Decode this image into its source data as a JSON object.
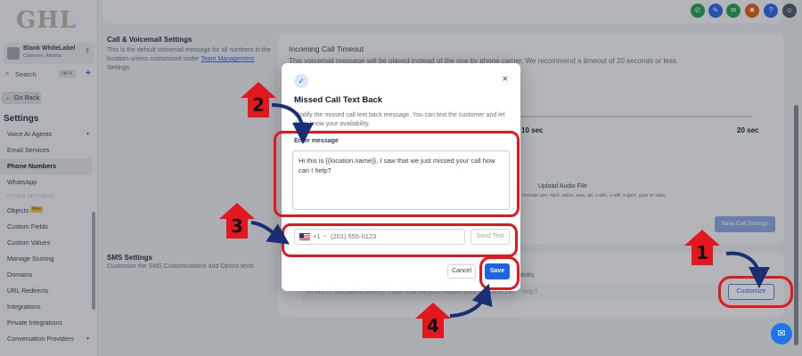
{
  "brand": {
    "logo": "GHL"
  },
  "account": {
    "name": "Blank WhiteLabel",
    "location": "Canmore, Alberta"
  },
  "search": {
    "label": "Search",
    "shortcut": "ctrl K"
  },
  "sidebar": {
    "go_back": "Go Back",
    "settings_title": "Settings",
    "items": [
      {
        "label": "Voice AI Agents"
      },
      {
        "label": "Email Services"
      },
      {
        "label": "Phone Numbers"
      },
      {
        "label": "WhatsApp"
      },
      {
        "label": "OTHER SETTINGS"
      },
      {
        "label": "Objects",
        "badge": "New"
      },
      {
        "label": "Custom Fields"
      },
      {
        "label": "Custom Values"
      },
      {
        "label": "Manage Scoring"
      },
      {
        "label": "Domains"
      },
      {
        "label": "URL Redirects"
      },
      {
        "label": "Integrations"
      },
      {
        "label": "Private Integrations"
      },
      {
        "label": "Conversation Providers"
      }
    ]
  },
  "topbar": {
    "icons": [
      "phone-icon",
      "megaphone-icon",
      "bell-icon",
      "gear-icon",
      "help-icon",
      "avatar"
    ],
    "colors": {
      "phone": "#1e9e4a",
      "blue": "#2563eb",
      "orange": "#e8590c"
    }
  },
  "main": {
    "section_title": "Call & Voicemail Settings",
    "section_desc_a": "This is the default voicemail message for all numbers in the location unless customized under",
    "section_desc_link": "Team Management",
    "section_desc_b": "Settings.",
    "timeout_label": "Incoming Call Timeout",
    "timeout_desc": "This voicemail message will be played instead of the one by phone carrier. We recommend a timeout of 20 seconds or less.",
    "tick_10": "10 sec",
    "tick_20": "20 sec",
    "upload_label": "Upload Audio File",
    "formats": "formats are: mp3, wave, wav, aif, x-aifc, x-aiff, x-gsm, gsm or ulaw.",
    "save_call_settings": "Save Call Settings",
    "sms_title": "SMS Settings",
    "sms_desc": "Customize the SMS Customizations and Optout texts",
    "sms_preview": "Hi this is {{location.name}}, I saw that we just missed your call how can I help?",
    "sms_tail": "ability",
    "customize": "Customize"
  },
  "modal": {
    "title": "Missed Call Text Back",
    "desc": "Modify the missed call text back message. You can text the customer and let them know your availability.",
    "field_label": "Enter message",
    "message": "Hi this is {{location.name}}, I saw that we just missed your call how can I help?",
    "country_code": "+1",
    "phone_placeholder": "(201) 555-0123",
    "send_test": "Send Test",
    "cancel": "Cancel",
    "save": "Save",
    "close": "×"
  },
  "annotations": {
    "color": "#e3181e",
    "steps": [
      "1",
      "2",
      "3",
      "4"
    ]
  }
}
